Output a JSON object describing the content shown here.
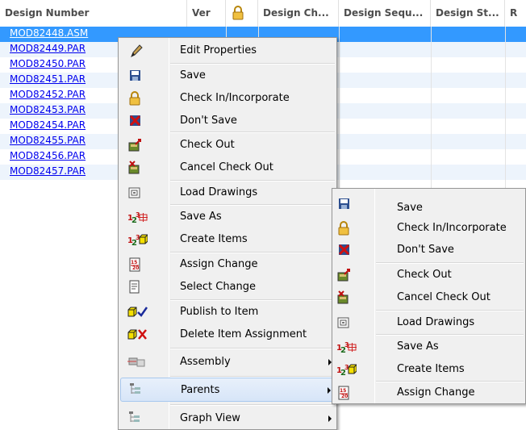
{
  "table": {
    "columns": [
      {
        "label": "Design Number"
      },
      {
        "label": "Ver"
      },
      {
        "label": ""
      },
      {
        "label": "Design Ch..."
      },
      {
        "label": "Design Sequ..."
      },
      {
        "label": "Design St..."
      },
      {
        "label": "R"
      }
    ],
    "rows": [
      {
        "name": "MOD82448.ASM",
        "selected": true
      },
      {
        "name": "MOD82449.PAR"
      },
      {
        "name": "MOD82450.PAR"
      },
      {
        "name": "MOD82451.PAR"
      },
      {
        "name": "MOD82452.PAR"
      },
      {
        "name": "MOD82453.PAR"
      },
      {
        "name": "MOD82454.PAR"
      },
      {
        "name": "MOD82455.PAR"
      },
      {
        "name": "MOD82456.PAR"
      },
      {
        "name": "MOD82457.PAR"
      }
    ]
  },
  "context_menu": {
    "items": [
      {
        "label": "Edit Properties",
        "icon": "pencil-icon"
      },
      {
        "label": "Save",
        "icon": "floppy-disk-icon"
      },
      {
        "label": "Check In/Incorporate",
        "icon": "padlock-icon"
      },
      {
        "label": "Don't Save",
        "icon": "floppy-x-icon"
      },
      {
        "label": "Check Out",
        "icon": "check-out-icon"
      },
      {
        "label": "Cancel Check Out",
        "icon": "cancel-check-out-icon"
      },
      {
        "label": "Load Drawings",
        "icon": "load-drawings-icon"
      },
      {
        "label": "Save As",
        "icon": "save-as-icon"
      },
      {
        "label": "Create Items",
        "icon": "create-items-icon"
      },
      {
        "label": "Assign Change",
        "icon": "assign-change-icon"
      },
      {
        "label": "Select Change",
        "icon": "select-change-icon"
      },
      {
        "label": "Publish to Item",
        "icon": "publish-item-icon"
      },
      {
        "label": "Delete Item Assignment",
        "icon": "delete-item-icon"
      },
      {
        "label": "Assembly",
        "icon": "assembly-icon"
      },
      {
        "label": "Parents",
        "icon": "tree-icon"
      },
      {
        "label": "Graph View",
        "icon": "tree-icon"
      }
    ]
  },
  "submenu": {
    "items": [
      {
        "label": "Save",
        "icon": "floppy-disk-icon"
      },
      {
        "label": "Check In/Incorporate",
        "icon": "padlock-icon"
      },
      {
        "label": "Don't Save",
        "icon": "floppy-x-icon"
      },
      {
        "label": "Check Out",
        "icon": "check-out-icon"
      },
      {
        "label": "Cancel Check Out",
        "icon": "cancel-check-out-icon"
      },
      {
        "label": "Load Drawings",
        "icon": "load-drawings-icon"
      },
      {
        "label": "Save As",
        "icon": "save-as-icon"
      },
      {
        "label": "Create Items",
        "icon": "create-items-icon"
      },
      {
        "label": "Assign Change",
        "icon": "assign-change-icon"
      }
    ]
  },
  "colors": {
    "selection": "#3399ff",
    "link": "#0000ee",
    "menu_bg": "#f0f0f0",
    "highlight": "#d7e5f8"
  }
}
